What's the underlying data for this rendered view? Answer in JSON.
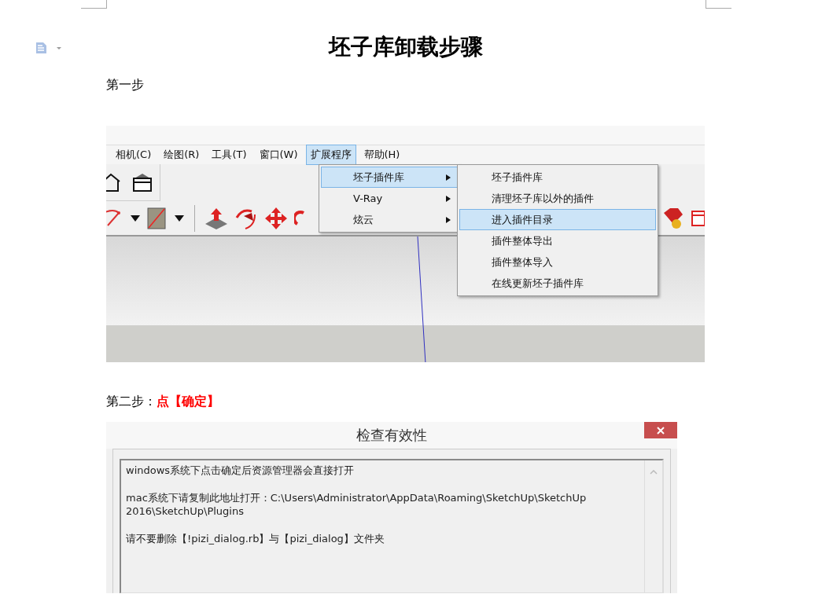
{
  "title": "坯子库卸载步骤",
  "step1": {
    "label": "第一步"
  },
  "screenshot": {
    "menubar": [
      {
        "label": "相机(C)",
        "selected": false
      },
      {
        "label": "绘图(R)",
        "selected": false
      },
      {
        "label": "工具(T)",
        "selected": false
      },
      {
        "label": "窗口(W)",
        "selected": false
      },
      {
        "label": "扩展程序",
        "selected": true
      },
      {
        "label": "帮助(H)",
        "selected": false
      }
    ],
    "menu": [
      {
        "label": "坯子插件库",
        "selected": true
      },
      {
        "label": "V-Ray",
        "selected": false
      },
      {
        "label": "炫云",
        "selected": false
      }
    ],
    "submenu": [
      {
        "label": "坯子插件库",
        "selected": false
      },
      {
        "label": "清理坯子库以外的插件",
        "selected": false
      },
      {
        "label": "进入插件目录",
        "selected": true
      },
      {
        "label": "插件整体导出",
        "selected": false
      },
      {
        "label": "插件整体导入",
        "selected": false
      },
      {
        "label": "在线更新坯子插件库",
        "selected": false
      }
    ]
  },
  "step2": {
    "label": "第二步：",
    "highlight": "点【确定】"
  },
  "dialog": {
    "title": "检查有效性",
    "lines": [
      "windows系统下点击确定后资源管理器会直接打开",
      "mac系统下请复制此地址打开：C:\\Users\\Administrator\\AppData\\Roaming\\SketchUp\\SketchUp 2016\\SketchUp\\Plugins",
      "请不要删除【!pizi_dialog.rb】与【pizi_dialog】文件夹"
    ]
  }
}
